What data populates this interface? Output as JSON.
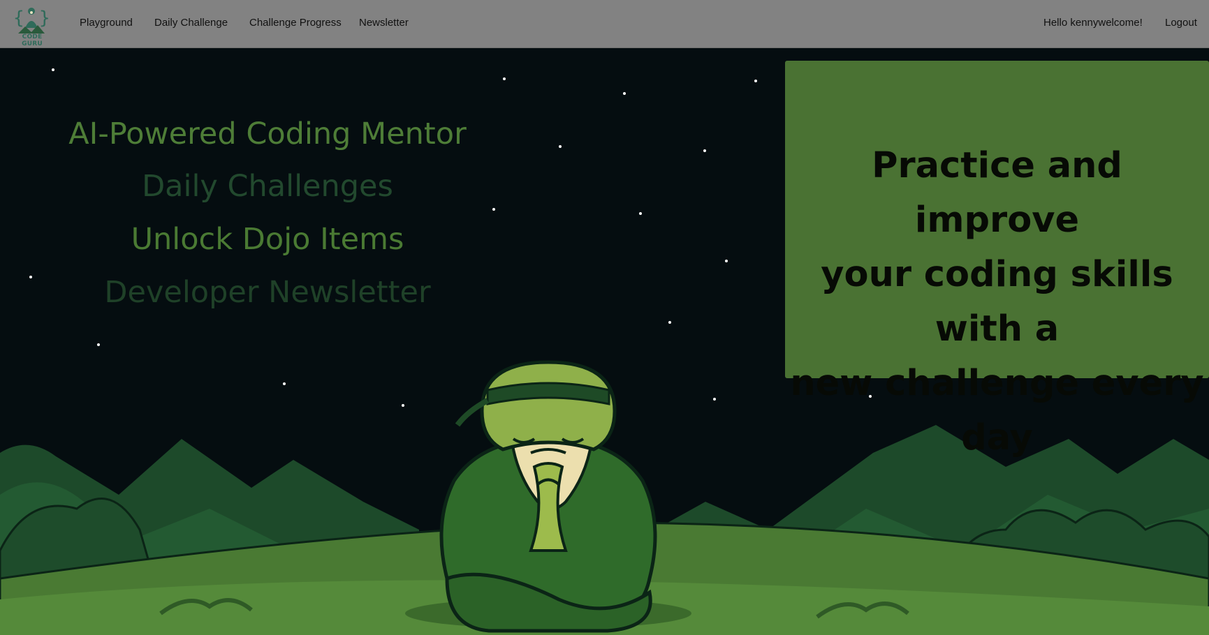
{
  "brand": {
    "logo_text": "CODE GURU",
    "icon": "guru-logo-icon",
    "accent": "#2f6b5a"
  },
  "nav": {
    "links": [
      {
        "label": "Playground"
      },
      {
        "label": "Daily Challenge"
      },
      {
        "label": "Challenge Progress"
      },
      {
        "label": "Newsletter"
      }
    ],
    "greeting": "Hello kennywelcome!",
    "logout_label": "Logout"
  },
  "hero": {
    "features": [
      {
        "label": "AI-Powered Coding Mentor",
        "color": "#4e7d37"
      },
      {
        "label": "Daily Challenges",
        "color": "#22492e"
      },
      {
        "label": "Unlock Dojo Items",
        "color": "#4a7a33"
      },
      {
        "label": "Developer Newsletter",
        "color": "#1f4128"
      }
    ],
    "promo_lines": [
      "Practice and improve",
      "your coding skills with a",
      "new challenge every day"
    ],
    "promo_bg": "#4a7233",
    "illustration": "meditating-guru-illustration"
  }
}
